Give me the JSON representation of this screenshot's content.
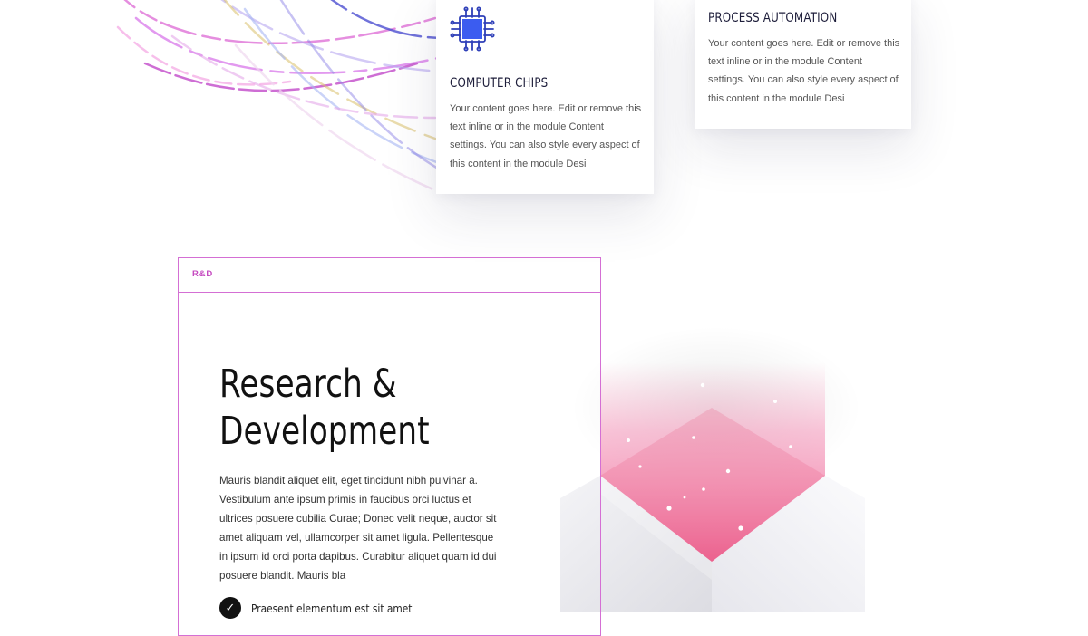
{
  "cards": [
    {
      "icon": "cpu-chip-icon",
      "title": "COMPUTER CHIPS",
      "text": "Your content goes here. Edit or remove this text inline or in the module Content settings. You can also style every aspect of this content in the module Desi"
    },
    {
      "title": "PROCESS AUTOMATION",
      "text": "Your content goes here. Edit or remove this text inline or in the module Content settings. You can also style every aspect of this content in the module Desi"
    }
  ],
  "rd": {
    "tab_label": "R&D",
    "title_line1": "Research &",
    "title_line2": "Development",
    "body": "Mauris blandit aliquet elit, eget tincidunt nibh pulvinar a. Vestibulum ante ipsum primis in faucibus orci luctus et ultrices posuere cubilia Curae; Donec velit neque, auctor sit amet aliquam vel, ullamcorper sit amet ligula. Pellentesque in ipsum id orci porta dapibus. Curabitur aliquet quam id dui posuere blandit. Mauris bla",
    "checklist": [
      {
        "icon": "checkmark-icon",
        "label": "Praesent elementum est sit amet"
      }
    ]
  },
  "colors": {
    "accent_magenta": "#c54ac0",
    "border_pink": "#d46fd4",
    "chip_blue": "#3b5cf0",
    "chip_outline": "#2e3fb8",
    "glow_pink": "#f06c9b",
    "heading_dark": "#1d1d3a"
  }
}
